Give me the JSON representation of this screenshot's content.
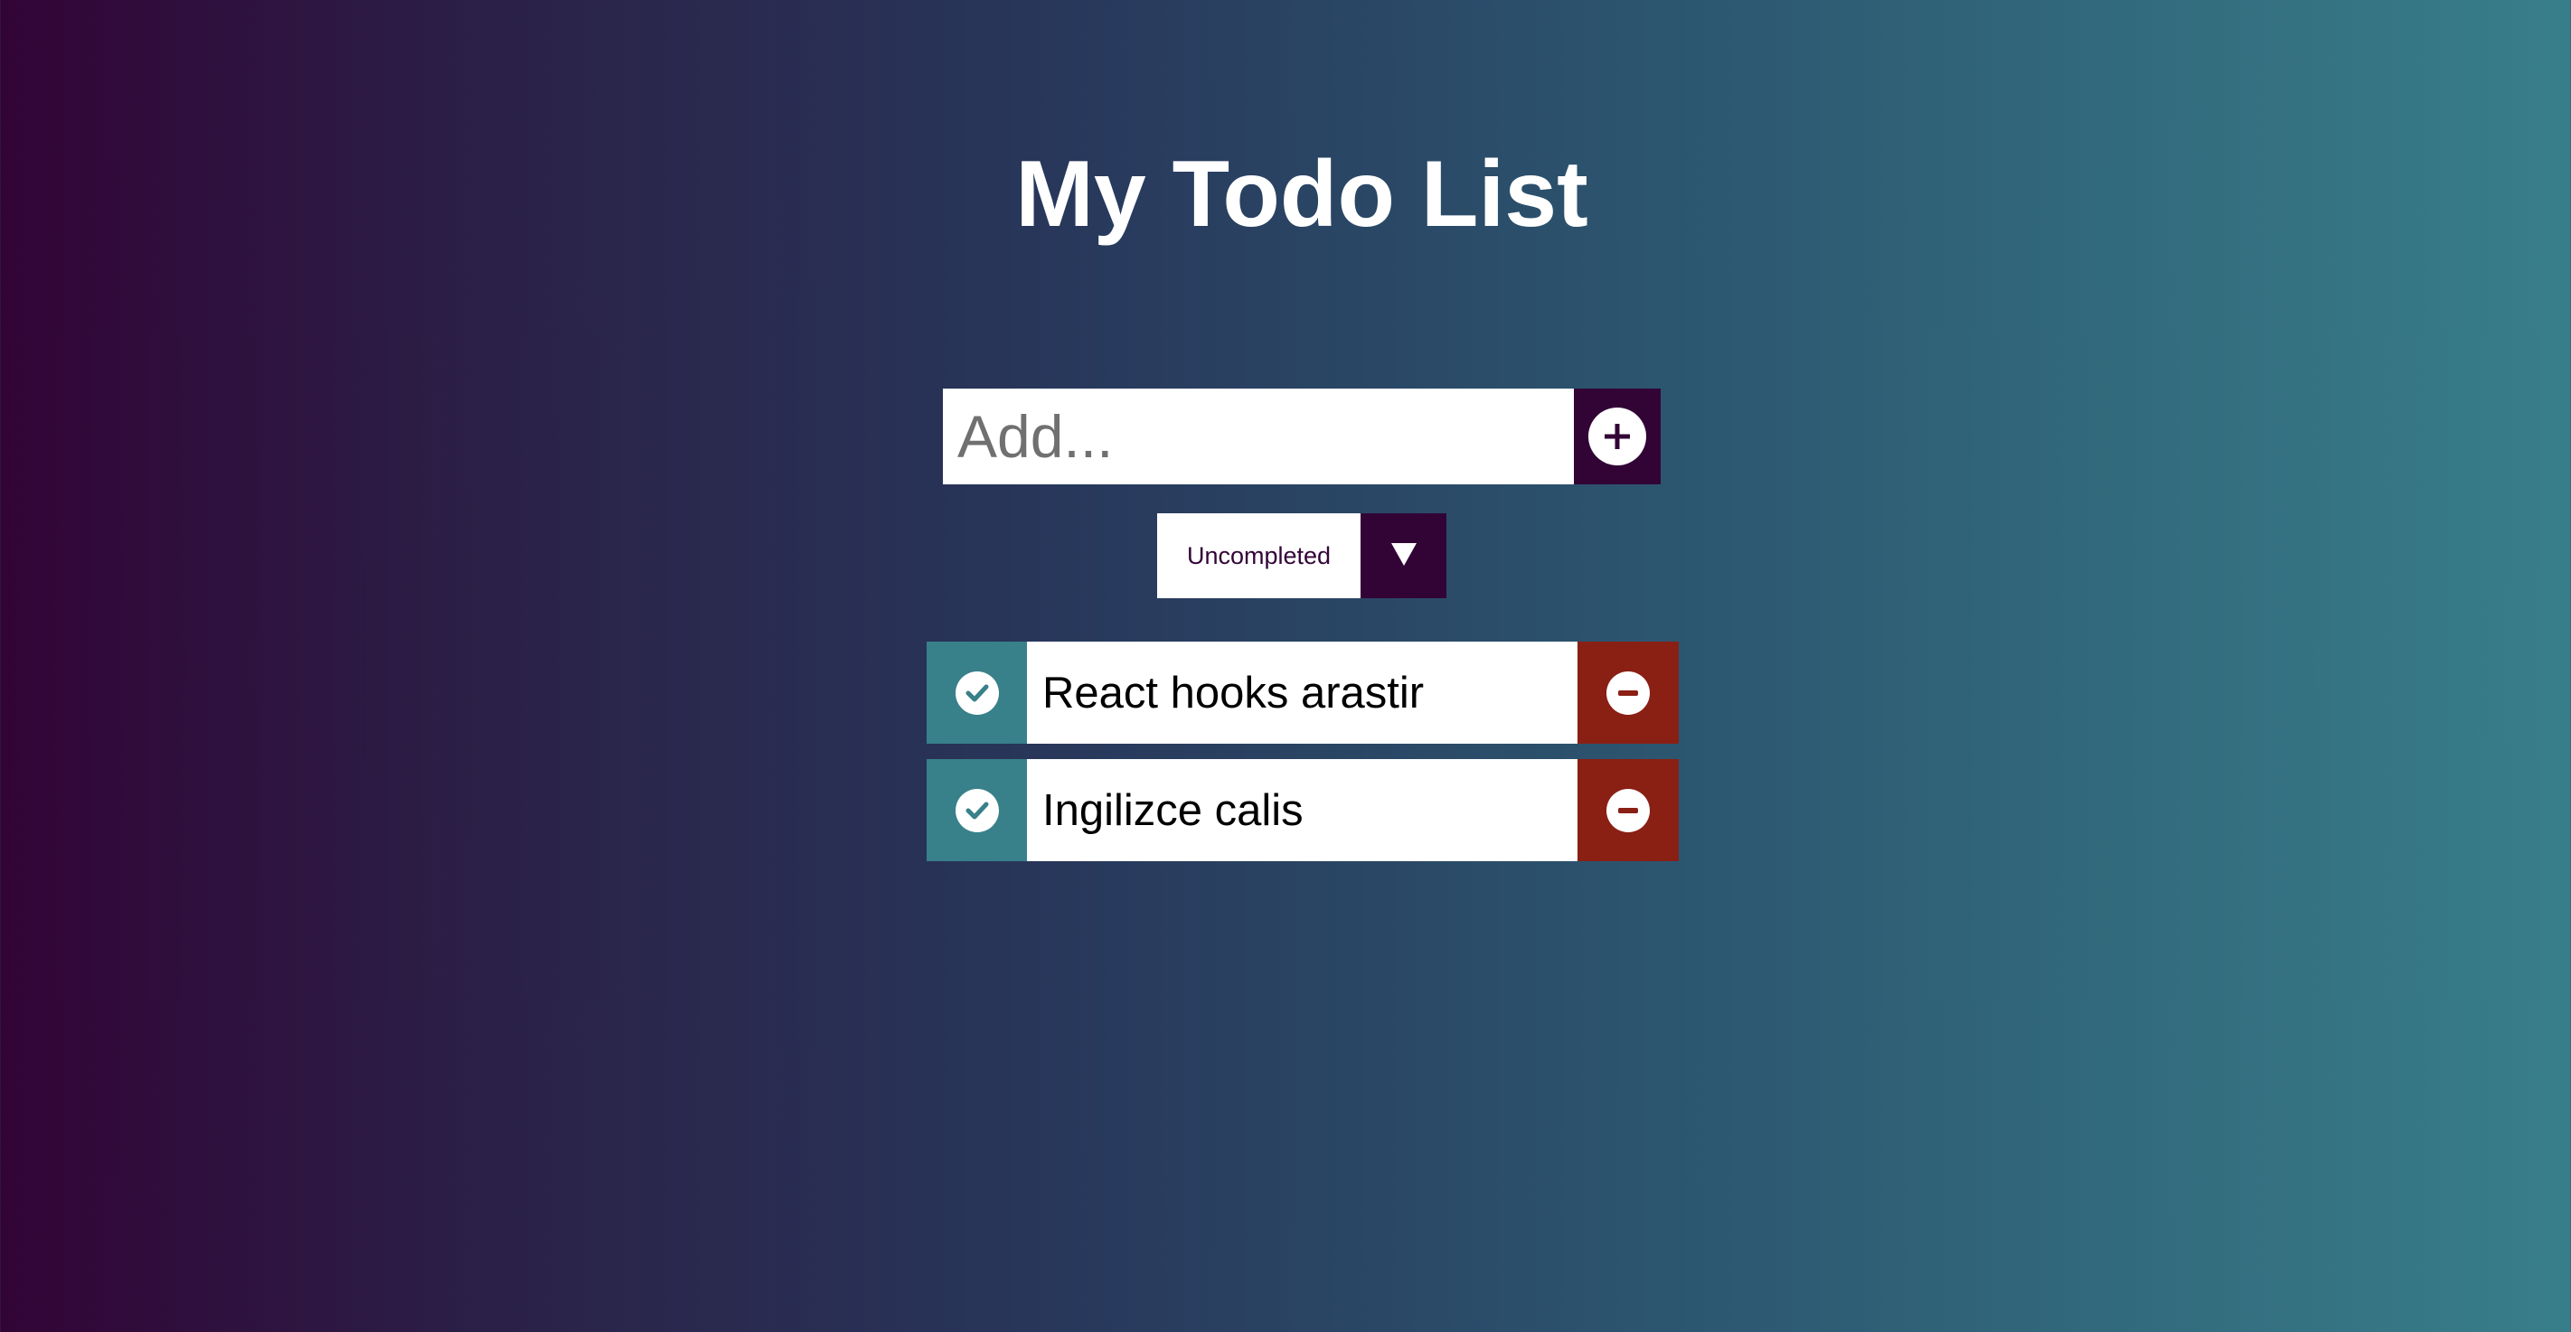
{
  "header": {
    "title": "My Todo List"
  },
  "form": {
    "input_placeholder": "Add...",
    "input_value": "",
    "add_icon": "plus-circle-icon",
    "filter": {
      "selected": "Uncompleted",
      "arrow_icon": "caret-down-icon"
    }
  },
  "todos": [
    {
      "text": "React hooks arastir",
      "complete_icon": "check-circle-icon",
      "delete_icon": "minus-circle-icon"
    },
    {
      "text": "Ingilizce calis",
      "complete_icon": "check-circle-icon",
      "delete_icon": "minus-circle-icon"
    }
  ],
  "colors": {
    "gradient_start": "#320436",
    "gradient_end": "#387e8a",
    "dark_accent": "#320436",
    "complete_button": "#38808a",
    "delete_button": "#8a1f14",
    "item_background": "#ffffff"
  }
}
